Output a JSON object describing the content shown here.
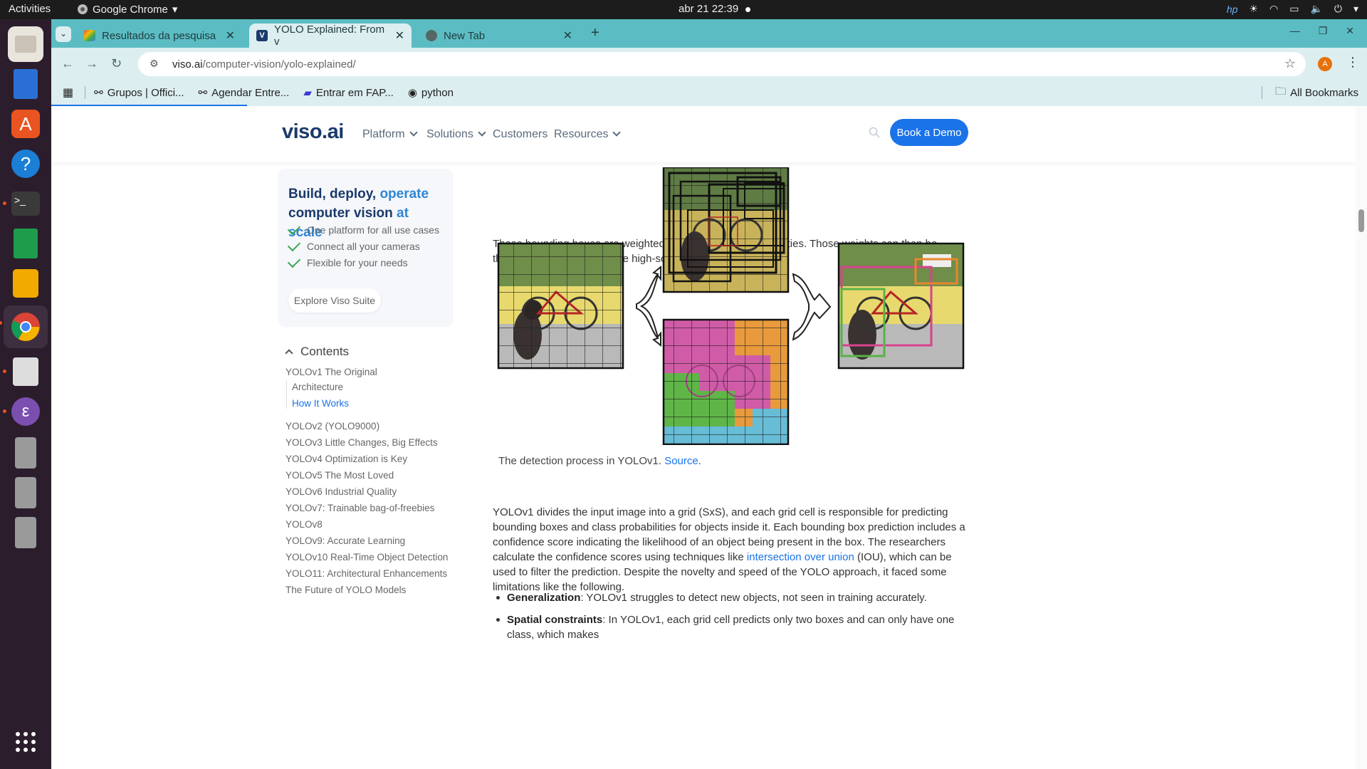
{
  "topbar": {
    "activities": "Activities",
    "app_name": "Google Chrome",
    "clock": "abr 21  22:39"
  },
  "browser": {
    "tabs": [
      {
        "label": "Resultados da pesquisa",
        "favicon": "gmail"
      },
      {
        "label": "YOLO Explained: From v",
        "favicon": "viso"
      },
      {
        "label": "New Tab",
        "favicon": "chrome"
      }
    ],
    "url_host": "viso.ai",
    "url_path": "/computer-vision/yolo-explained/",
    "profile_initial": "A",
    "bookmarks": [
      "Grupos | Offici...",
      "Agendar Entre...",
      "Entrar em FAP...",
      "python"
    ],
    "all_bookmarks": "All Bookmarks"
  },
  "site": {
    "logo": "viso.ai",
    "nav": [
      "Platform",
      "Solutions",
      "Customers",
      "Resources"
    ],
    "demo_button": "Book a Demo"
  },
  "sidebar": {
    "promo_title_1": "Build, deploy,",
    "promo_title_hl1": "operate",
    "promo_title_2": "computer vision",
    "promo_title_hl2": "at scale",
    "checks": [
      "One platform for all use cases",
      "Connect all your cameras",
      "Flexible for your needs"
    ],
    "explore_button": "Explore Viso Suite",
    "contents_title": "Contents",
    "toc": [
      "YOLOv1 The Original",
      "Architecture",
      "How It Works",
      "YOLOv2 (YOLO9000)",
      "YOLOv3 Little Changes, Big Effects",
      "YOLOv4 Optimization is Key",
      "YOLOv5 The Most Loved",
      "YOLOv6 Industrial Quality",
      "YOLOv7: Trainable bag-of-freebies",
      "YOLOv8",
      "YOLOv9: Accurate Learning",
      "YOLOv10 Real-Time Object Detection",
      "YOLO11: Architectural Enhancements",
      "The Future of YOLO Models"
    ]
  },
  "article": {
    "intro": "These bounding boxes are weighted by the predicted probabilities. Those weights can then be thresholded to show only the high-scoring detections.",
    "caption_text": "The detection process in YOLOv1.",
    "caption_link": "Source",
    "para_1": "YOLOv1 divides the input image into a grid (SxS), and each grid cell is responsible for predicting bounding boxes and class probabilities for objects inside it. Each bounding box prediction includes a confidence score indicating the likelihood of an object being present in the box. The researchers calculate the confidence scores using techniques like",
    "para_link": "intersection over union",
    "para_2": "(IOU), which can be used to filter the prediction. Despite the novelty and speed of the YOLO approach, it faced some limitations like the following.",
    "bullets": [
      {
        "title": "Generalization",
        "text": ": YOLOv1 struggles to detect new objects, not seen in training accurately."
      },
      {
        "title": "Spatial constraints",
        "text": ": In YOLOv1, each grid cell predicts only two boxes and can only have one class, which makes"
      }
    ]
  },
  "colors": {
    "accent": "#1a73e8",
    "tabstrip": "#5bbdc3",
    "toolbar": "#dceef0",
    "dock": "#2b1d2c"
  }
}
